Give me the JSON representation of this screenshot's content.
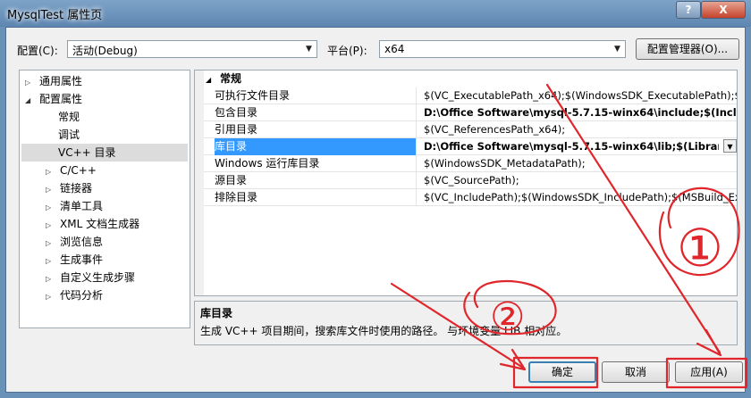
{
  "window": {
    "title": "MysqlTest 属性页",
    "help_label": "?",
    "close_label": "X"
  },
  "config": {
    "label": "配置(C):",
    "value": "活动(Debug)",
    "platform_label": "平台(P):",
    "platform_value": "x64",
    "manager_button": "配置管理器(O)..."
  },
  "tree": {
    "items": [
      {
        "label": "通用属性"
      },
      {
        "label": "配置属性"
      },
      {
        "label": "常规"
      },
      {
        "label": "调试"
      },
      {
        "label": "VC++ 目录"
      },
      {
        "label": "C/C++"
      },
      {
        "label": "链接器"
      },
      {
        "label": "清单工具"
      },
      {
        "label": "XML 文档生成器"
      },
      {
        "label": "浏览信息"
      },
      {
        "label": "生成事件"
      },
      {
        "label": "自定义生成步骤"
      },
      {
        "label": "代码分析"
      }
    ]
  },
  "grid": {
    "category": "常规",
    "rows": [
      {
        "name": "可执行文件目录",
        "value": "$(VC_ExecutablePath_x64);$(WindowsSDK_ExecutablePath);$("
      },
      {
        "name": "包含目录",
        "value": "D:\\Office Software\\mysql-5.7.15-winx64\\include;$(Includ"
      },
      {
        "name": "引用目录",
        "value": "$(VC_ReferencesPath_x64);"
      },
      {
        "name": "库目录",
        "value": "D:\\Office Software\\mysql-5.7.15-winx64\\lib;$(LibraryP"
      },
      {
        "name": "Windows 运行库目录",
        "value": "$(WindowsSDK_MetadataPath);"
      },
      {
        "name": "源目录",
        "value": "$(VC_SourcePath);"
      },
      {
        "name": "排除目录",
        "value": "$(VC_IncludePath);$(WindowsSDK_IncludePath);$(MSBuild_Ex"
      }
    ]
  },
  "description": {
    "title": "库目录",
    "text": "生成 VC++ 项目期间，搜索库文件时使用的路径。 与环境变量 LIB 相对应。"
  },
  "buttons": {
    "ok": "确定",
    "cancel": "取消",
    "apply": "应用(A)"
  },
  "annotations": {
    "color": "#e0262b",
    "mark_1": "①",
    "mark_2": "②"
  }
}
